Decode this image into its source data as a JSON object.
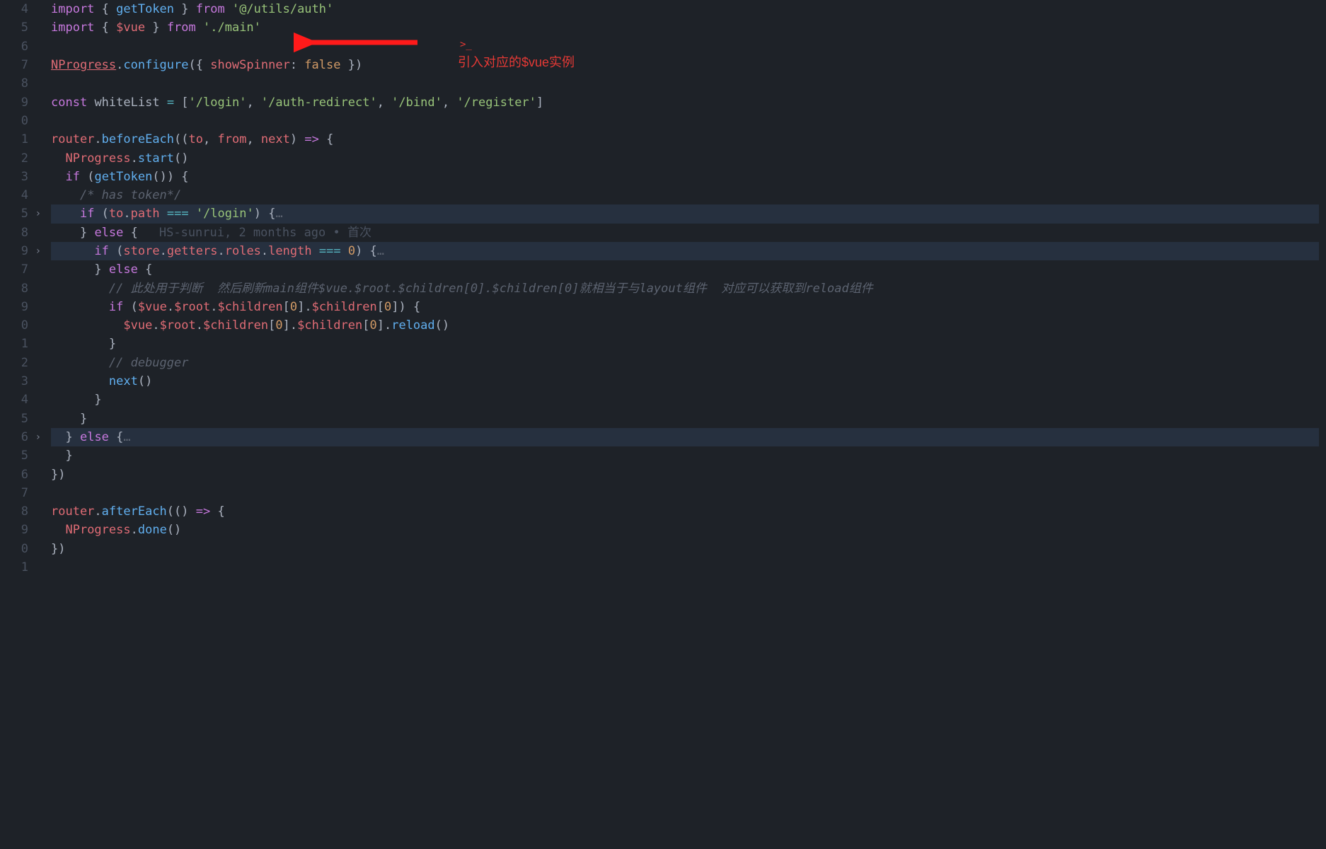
{
  "annotation": {
    "caret": ">_",
    "text": "引入对应的$vue实例"
  },
  "blame": "HS-sunrui, 2 months ago • 首次",
  "lines": [
    {
      "num": "4",
      "fold": false,
      "highlight": false,
      "tokens": [
        {
          "cls": "kw",
          "t": "import"
        },
        {
          "cls": "punct",
          "t": " { "
        },
        {
          "cls": "fn",
          "t": "getToken"
        },
        {
          "cls": "punct",
          "t": " } "
        },
        {
          "cls": "kw",
          "t": "from"
        },
        {
          "cls": "punct",
          "t": " "
        },
        {
          "cls": "str",
          "t": "'@/utils/auth'"
        }
      ]
    },
    {
      "num": "5",
      "fold": false,
      "highlight": false,
      "tokens": [
        {
          "cls": "kw",
          "t": "import"
        },
        {
          "cls": "punct",
          "t": " { "
        },
        {
          "cls": "var",
          "t": "$vue"
        },
        {
          "cls": "punct",
          "t": " } "
        },
        {
          "cls": "kw",
          "t": "from"
        },
        {
          "cls": "punct",
          "t": " "
        },
        {
          "cls": "str",
          "t": "'./main'"
        }
      ]
    },
    {
      "num": "6",
      "fold": false,
      "highlight": false,
      "tokens": []
    },
    {
      "num": "7",
      "fold": false,
      "highlight": false,
      "tokens": [
        {
          "cls": "var underline",
          "t": "NProgress"
        },
        {
          "cls": "punct",
          "t": "."
        },
        {
          "cls": "fn-call",
          "t": "configure"
        },
        {
          "cls": "punct",
          "t": "({ "
        },
        {
          "cls": "prop",
          "t": "showSpinner"
        },
        {
          "cls": "punct",
          "t": ": "
        },
        {
          "cls": "const",
          "t": "false"
        },
        {
          "cls": "punct",
          "t": " })"
        }
      ]
    },
    {
      "num": "8",
      "fold": false,
      "highlight": false,
      "tokens": []
    },
    {
      "num": "9",
      "fold": false,
      "highlight": false,
      "tokens": [
        {
          "cls": "kw",
          "t": "const"
        },
        {
          "cls": "punct",
          "t": " "
        },
        {
          "cls": "ident",
          "t": "whiteList"
        },
        {
          "cls": "punct",
          "t": " "
        },
        {
          "cls": "op",
          "t": "="
        },
        {
          "cls": "punct",
          "t": " ["
        },
        {
          "cls": "str",
          "t": "'/login'"
        },
        {
          "cls": "punct",
          "t": ", "
        },
        {
          "cls": "str",
          "t": "'/auth-redirect'"
        },
        {
          "cls": "punct",
          "t": ", "
        },
        {
          "cls": "str",
          "t": "'/bind'"
        },
        {
          "cls": "punct",
          "t": ", "
        },
        {
          "cls": "str",
          "t": "'/register'"
        },
        {
          "cls": "punct",
          "t": "]"
        }
      ]
    },
    {
      "num": "0",
      "fold": false,
      "highlight": false,
      "tokens": []
    },
    {
      "num": "1",
      "fold": false,
      "highlight": false,
      "tokens": [
        {
          "cls": "var",
          "t": "router"
        },
        {
          "cls": "punct",
          "t": "."
        },
        {
          "cls": "fn-call",
          "t": "beforeEach"
        },
        {
          "cls": "punct",
          "t": "(("
        },
        {
          "cls": "param",
          "t": "to"
        },
        {
          "cls": "punct",
          "t": ", "
        },
        {
          "cls": "param",
          "t": "from"
        },
        {
          "cls": "punct",
          "t": ", "
        },
        {
          "cls": "param",
          "t": "next"
        },
        {
          "cls": "punct",
          "t": ") "
        },
        {
          "cls": "kw",
          "t": "=>"
        },
        {
          "cls": "punct",
          "t": " {"
        }
      ]
    },
    {
      "num": "2",
      "fold": false,
      "highlight": false,
      "indent": 1,
      "tokens": [
        {
          "cls": "var",
          "t": "NProgress"
        },
        {
          "cls": "punct",
          "t": "."
        },
        {
          "cls": "fn-call",
          "t": "start"
        },
        {
          "cls": "punct",
          "t": "()"
        }
      ]
    },
    {
      "num": "3",
      "fold": false,
      "highlight": false,
      "indent": 1,
      "tokens": [
        {
          "cls": "kw",
          "t": "if"
        },
        {
          "cls": "punct",
          "t": " ("
        },
        {
          "cls": "fn-call",
          "t": "getToken"
        },
        {
          "cls": "punct",
          "t": "()) {"
        }
      ]
    },
    {
      "num": "4",
      "fold": false,
      "highlight": false,
      "indent": 2,
      "tokens": [
        {
          "cls": "comment",
          "t": "/* has token*/"
        }
      ]
    },
    {
      "num": "5",
      "fold": true,
      "highlight": true,
      "indent": 2,
      "tokens": [
        {
          "cls": "kw",
          "t": "if"
        },
        {
          "cls": "punct",
          "t": " ("
        },
        {
          "cls": "var",
          "t": "to"
        },
        {
          "cls": "punct",
          "t": "."
        },
        {
          "cls": "prop",
          "t": "path"
        },
        {
          "cls": "punct",
          "t": " "
        },
        {
          "cls": "op",
          "t": "==="
        },
        {
          "cls": "punct",
          "t": " "
        },
        {
          "cls": "str",
          "t": "'/login'"
        },
        {
          "cls": "punct",
          "t": ") {"
        },
        {
          "cls": "ellipsis",
          "t": "…"
        }
      ]
    },
    {
      "num": "8",
      "fold": false,
      "highlight": false,
      "indent": 2,
      "blame": true,
      "tokens": [
        {
          "cls": "punct",
          "t": "} "
        },
        {
          "cls": "kw",
          "t": "else"
        },
        {
          "cls": "punct",
          "t": " {"
        }
      ]
    },
    {
      "num": "9",
      "fold": true,
      "highlight": true,
      "indent": 3,
      "tokens": [
        {
          "cls": "kw",
          "t": "if"
        },
        {
          "cls": "punct",
          "t": " ("
        },
        {
          "cls": "var",
          "t": "store"
        },
        {
          "cls": "punct",
          "t": "."
        },
        {
          "cls": "prop",
          "t": "getters"
        },
        {
          "cls": "punct",
          "t": "."
        },
        {
          "cls": "prop",
          "t": "roles"
        },
        {
          "cls": "punct",
          "t": "."
        },
        {
          "cls": "prop",
          "t": "length"
        },
        {
          "cls": "punct",
          "t": " "
        },
        {
          "cls": "op",
          "t": "==="
        },
        {
          "cls": "punct",
          "t": " "
        },
        {
          "cls": "num",
          "t": "0"
        },
        {
          "cls": "punct",
          "t": ") {"
        },
        {
          "cls": "ellipsis",
          "t": "…"
        }
      ]
    },
    {
      "num": "7",
      "fold": false,
      "highlight": false,
      "indent": 3,
      "tokens": [
        {
          "cls": "punct",
          "t": "} "
        },
        {
          "cls": "kw",
          "t": "else"
        },
        {
          "cls": "punct",
          "t": " {"
        }
      ]
    },
    {
      "num": "8",
      "fold": false,
      "highlight": false,
      "indent": 4,
      "tokens": [
        {
          "cls": "comment",
          "t": "// 此处用于判断  然后刷新main组件$vue.$root.$children[0].$children[0]就相当于与layout组件  对应可以获取到reload组件"
        }
      ]
    },
    {
      "num": "9",
      "fold": false,
      "highlight": false,
      "indent": 4,
      "tokens": [
        {
          "cls": "kw",
          "t": "if"
        },
        {
          "cls": "punct",
          "t": " ("
        },
        {
          "cls": "var",
          "t": "$vue"
        },
        {
          "cls": "punct",
          "t": "."
        },
        {
          "cls": "prop",
          "t": "$root"
        },
        {
          "cls": "punct",
          "t": "."
        },
        {
          "cls": "prop",
          "t": "$children"
        },
        {
          "cls": "punct",
          "t": "["
        },
        {
          "cls": "num",
          "t": "0"
        },
        {
          "cls": "punct",
          "t": "]."
        },
        {
          "cls": "prop",
          "t": "$children"
        },
        {
          "cls": "punct",
          "t": "["
        },
        {
          "cls": "num",
          "t": "0"
        },
        {
          "cls": "punct",
          "t": "]) {"
        }
      ]
    },
    {
      "num": "0",
      "fold": false,
      "highlight": false,
      "indent": 5,
      "tokens": [
        {
          "cls": "var",
          "t": "$vue"
        },
        {
          "cls": "punct",
          "t": "."
        },
        {
          "cls": "prop",
          "t": "$root"
        },
        {
          "cls": "punct",
          "t": "."
        },
        {
          "cls": "prop",
          "t": "$children"
        },
        {
          "cls": "punct",
          "t": "["
        },
        {
          "cls": "num",
          "t": "0"
        },
        {
          "cls": "punct",
          "t": "]."
        },
        {
          "cls": "prop",
          "t": "$children"
        },
        {
          "cls": "punct",
          "t": "["
        },
        {
          "cls": "num",
          "t": "0"
        },
        {
          "cls": "punct",
          "t": "]."
        },
        {
          "cls": "fn-call",
          "t": "reload"
        },
        {
          "cls": "punct",
          "t": "()"
        }
      ]
    },
    {
      "num": "1",
      "fold": false,
      "highlight": false,
      "indent": 4,
      "tokens": [
        {
          "cls": "punct",
          "t": "}"
        }
      ]
    },
    {
      "num": "2",
      "fold": false,
      "highlight": false,
      "indent": 4,
      "tokens": [
        {
          "cls": "comment",
          "t": "// debugger"
        }
      ]
    },
    {
      "num": "3",
      "fold": false,
      "highlight": false,
      "indent": 4,
      "tokens": [
        {
          "cls": "fn-call",
          "t": "next"
        },
        {
          "cls": "punct",
          "t": "()"
        }
      ]
    },
    {
      "num": "4",
      "fold": false,
      "highlight": false,
      "indent": 3,
      "tokens": [
        {
          "cls": "punct",
          "t": "}"
        }
      ]
    },
    {
      "num": "5",
      "fold": false,
      "highlight": false,
      "indent": 2,
      "tokens": [
        {
          "cls": "punct",
          "t": "}"
        }
      ]
    },
    {
      "num": "6",
      "fold": true,
      "highlight": true,
      "indent": 1,
      "tokens": [
        {
          "cls": "punct",
          "t": "} "
        },
        {
          "cls": "kw",
          "t": "else"
        },
        {
          "cls": "punct",
          "t": " {"
        },
        {
          "cls": "ellipsis",
          "t": "…"
        }
      ]
    },
    {
      "num": "5",
      "fold": false,
      "highlight": false,
      "indent": 1,
      "tokens": [
        {
          "cls": "punct",
          "t": "}"
        }
      ]
    },
    {
      "num": "6",
      "fold": false,
      "highlight": false,
      "tokens": [
        {
          "cls": "punct",
          "t": "})"
        }
      ]
    },
    {
      "num": "7",
      "fold": false,
      "highlight": false,
      "tokens": []
    },
    {
      "num": "8",
      "fold": false,
      "highlight": false,
      "tokens": [
        {
          "cls": "var",
          "t": "router"
        },
        {
          "cls": "punct",
          "t": "."
        },
        {
          "cls": "fn-call",
          "t": "afterEach"
        },
        {
          "cls": "punct",
          "t": "(() "
        },
        {
          "cls": "kw",
          "t": "=>"
        },
        {
          "cls": "punct",
          "t": " {"
        }
      ]
    },
    {
      "num": "9",
      "fold": false,
      "highlight": false,
      "indent": 1,
      "tokens": [
        {
          "cls": "var",
          "t": "NProgress"
        },
        {
          "cls": "punct",
          "t": "."
        },
        {
          "cls": "fn-call",
          "t": "done"
        },
        {
          "cls": "punct",
          "t": "()"
        }
      ]
    },
    {
      "num": "0",
      "fold": false,
      "highlight": false,
      "tokens": [
        {
          "cls": "punct",
          "t": "})"
        }
      ]
    },
    {
      "num": "1",
      "fold": false,
      "highlight": false,
      "tokens": []
    }
  ]
}
